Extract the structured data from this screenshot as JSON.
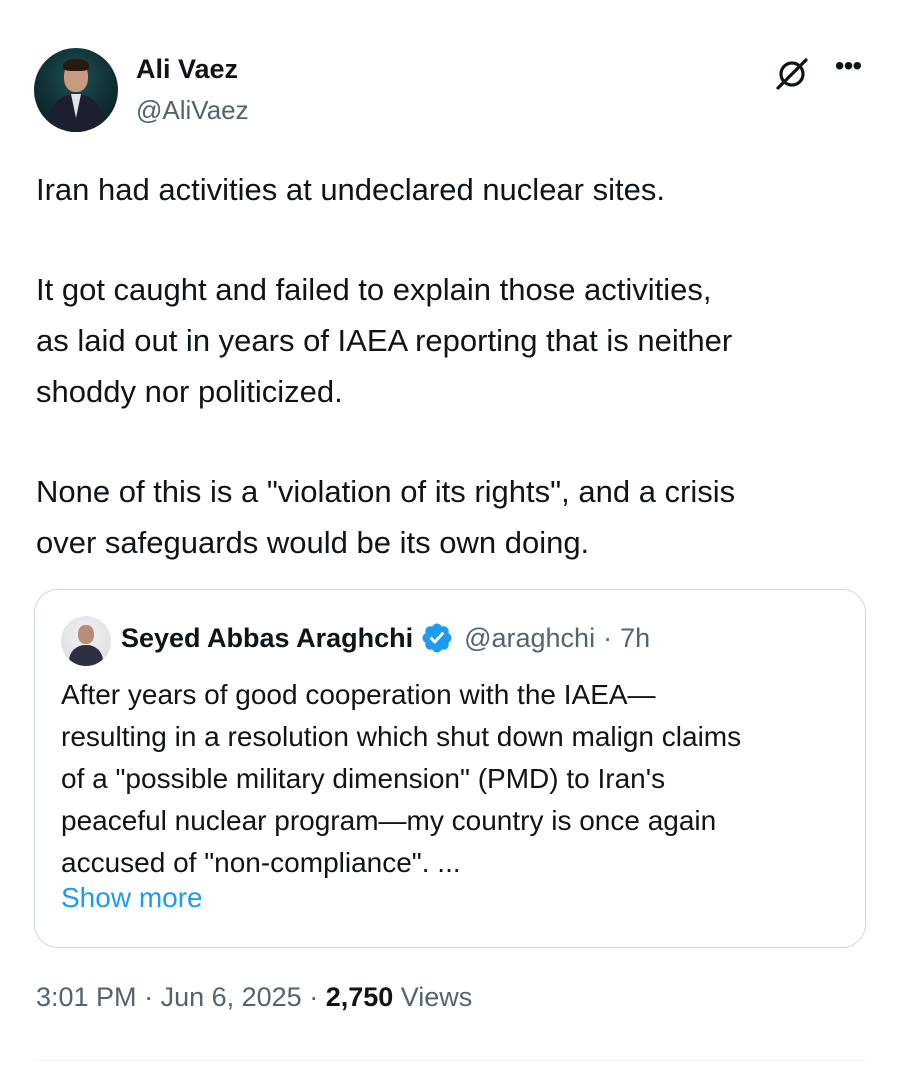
{
  "author": {
    "name": "Ali Vaez",
    "handle": "@AliVaez"
  },
  "icons": {
    "grok": "grok-icon",
    "more": "more-icon",
    "verified": "verified-badge-icon"
  },
  "more_glyph": "•••",
  "tweet": {
    "paragraphs": [
      "Iran had activities at undeclared nuclear sites.",
      "It got caught and failed to explain those activities,\nas laid out in years of IAEA reporting that is neither\nshoddy nor politicized.",
      "None of this is a \"violation of its rights\", and a crisis\nover safeguards would be its own doing."
    ]
  },
  "quoted": {
    "name": "Seyed Abbas Araghchi",
    "handle": "@araghchi",
    "separator": "·",
    "time": "7h",
    "text": "After years of good cooperation with the IAEA—\nresulting in a resolution which shut down malign claims\nof a \"possible military dimension\" (PMD) to Iran's\npeaceful nuclear program—my country is once again\naccused of \"non-compliance\". ...",
    "show_more": "Show more"
  },
  "meta": {
    "time": "3:01 PM",
    "sep1": " · ",
    "date": "Jun 6, 2025",
    "sep2": " · ",
    "views_count": "2,750",
    "views_label": " Views"
  },
  "colors": {
    "text": "#0f1419",
    "secondary": "#536471",
    "link": "#1d9bf0",
    "border": "#cfd9de"
  }
}
